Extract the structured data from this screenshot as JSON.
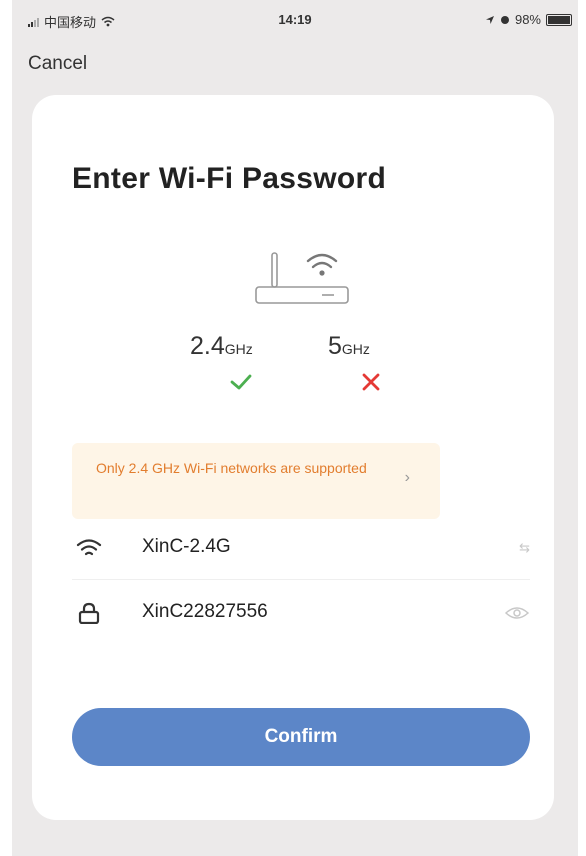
{
  "status_bar": {
    "carrier": "中国移动",
    "time": "14:19",
    "battery": "98%"
  },
  "header": {
    "cancel_label": "Cancel"
  },
  "dialog": {
    "title": "Enter Wi-Fi Password",
    "bands": [
      {
        "value": "2.4",
        "unit": "GHz",
        "supported": true
      },
      {
        "value": "5",
        "unit": "GHz",
        "supported": false
      }
    ],
    "notice": "Only 2.4 GHz Wi-Fi networks are supported",
    "network": {
      "ssid": "XinC-2.4G",
      "switch_label": "⇆"
    },
    "password": {
      "value": "XinC22827556"
    },
    "confirm_label": "Confirm"
  },
  "colors": {
    "accent": "#5c86c8",
    "notice_bg": "#fef5e7",
    "notice_text": "#e27d2e",
    "supported": "#4caf50",
    "unsupported": "#e53935"
  }
}
